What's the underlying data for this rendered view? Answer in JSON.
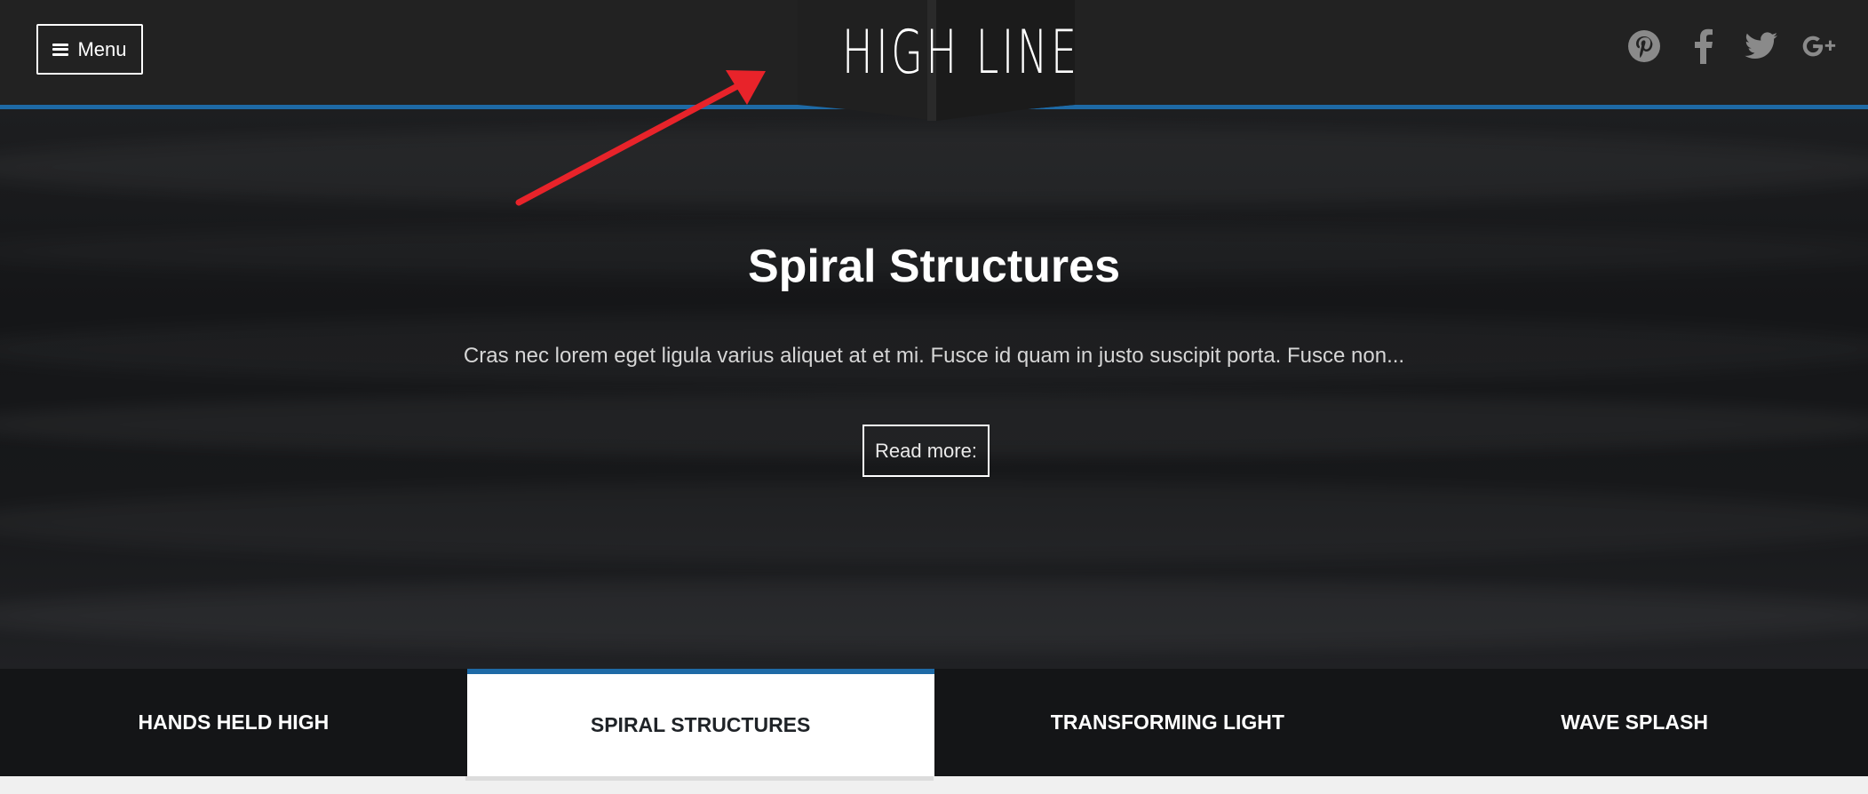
{
  "header": {
    "menu_label": "Menu",
    "logo_text": "HIGH LINE",
    "accent_color": "#1e6aa6",
    "social_icons": [
      "pinterest-icon",
      "facebook-icon",
      "twitter-icon",
      "google-plus-icon"
    ]
  },
  "hero": {
    "title": "Spiral Structures",
    "excerpt": "Cras nec lorem eget ligula varius aliquet at et mi. Fusce id quam in justo suscipit porta. Fusce non...",
    "read_more_label": "Read more:"
  },
  "tabs": [
    {
      "label": "Hands Held High",
      "active": false
    },
    {
      "label": "Spiral Structures",
      "active": true
    },
    {
      "label": "Transforming Light",
      "active": false
    },
    {
      "label": "Wave Splash",
      "active": false
    }
  ],
  "annotation": {
    "arrow_color": "#e8232a"
  }
}
